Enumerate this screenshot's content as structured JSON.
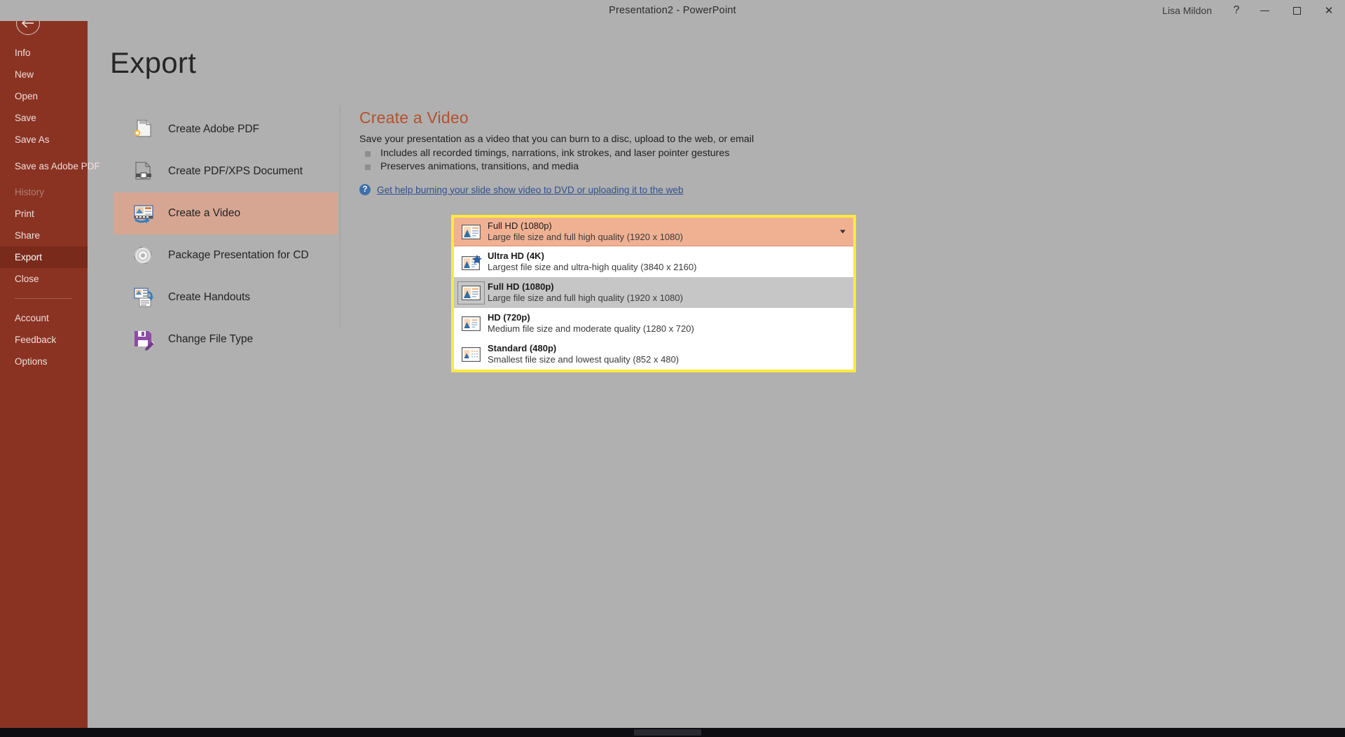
{
  "window": {
    "title": "Presentation2  -  PowerPoint",
    "user": "Lisa Mildon",
    "help_glyph": "?",
    "minimize_label": "Minimize",
    "restore_label": "Restore Down",
    "close_glyph": "✕"
  },
  "backstage": {
    "page_title": "Export",
    "back_label": "Back",
    "nav_items": [
      {
        "label": "Info",
        "state": "normal"
      },
      {
        "label": "New",
        "state": "normal"
      },
      {
        "label": "Open",
        "state": "normal"
      },
      {
        "label": "Save",
        "state": "normal"
      },
      {
        "label": "Save As",
        "state": "normal"
      },
      {
        "label": "Save as Adobe PDF",
        "state": "normal",
        "two_line": true
      },
      {
        "label": "History",
        "state": "disabled"
      },
      {
        "label": "Print",
        "state": "normal"
      },
      {
        "label": "Share",
        "state": "normal"
      },
      {
        "label": "Export",
        "state": "active"
      },
      {
        "label": "Close",
        "state": "normal"
      }
    ],
    "nav_items_bottom": [
      {
        "label": "Account",
        "state": "normal"
      },
      {
        "label": "Feedback",
        "state": "normal"
      },
      {
        "label": "Options",
        "state": "normal"
      }
    ]
  },
  "export_commands": [
    {
      "label": "Create Adobe PDF",
      "icon": "adobe-pdf-icon",
      "selected": false
    },
    {
      "label": "Create PDF/XPS Document",
      "icon": "pdf-xps-icon",
      "selected": false
    },
    {
      "label": "Create a Video",
      "icon": "video-icon",
      "selected": true
    },
    {
      "label": "Package Presentation for CD",
      "icon": "cd-disc-icon",
      "selected": false
    },
    {
      "label": "Create Handouts",
      "icon": "handouts-icon",
      "selected": false
    },
    {
      "label": "Change File Type",
      "icon": "file-type-icon",
      "selected": false
    }
  ],
  "pane": {
    "title": "Create a Video",
    "lead": "Save your presentation as a video that you can burn to a disc, upload to the web, or email",
    "bullets": [
      "Includes all recorded timings, narrations, ink strokes, and laser pointer gestures",
      "Preserves animations, transitions, and media"
    ],
    "help_icon_glyph": "?",
    "help_link": "Get help burning your slide show video to DVD or uploading it to the web"
  },
  "quality_dropdown": {
    "expanded": true,
    "selected_value": {
      "title": "Full HD (1080p)",
      "desc": "Large file size and full high quality (1920 x 1080)"
    },
    "options": [
      {
        "title": "Ultra HD (4K)",
        "desc": "Largest file size and ultra-high quality (3840 x 2160)",
        "icon": "slide-star-icon",
        "hovered": false,
        "boxed": false
      },
      {
        "title": "Full HD (1080p)",
        "desc": "Large file size and full high quality (1920 x 1080)",
        "icon": "slide-icon",
        "hovered": true,
        "boxed": true
      },
      {
        "title": "HD (720p)",
        "desc": "Medium file size and moderate quality (1280 x 720)",
        "icon": "slide-icon",
        "hovered": false,
        "boxed": false
      },
      {
        "title": "Standard (480p)",
        "desc": "Smallest file size and lowest quality (852 x 480)",
        "icon": "slide-dotted-icon",
        "hovered": false,
        "boxed": false
      }
    ]
  },
  "colors": {
    "sidebar_red": "#8a3323",
    "sidebar_active_red": "#7a2a1b",
    "backstage_gray": "#b0b0b0",
    "accent_orange": "#b5512e",
    "selected_peach": "#d7a693",
    "dropdown_selected_peach": "#f0b193",
    "highlight_yellow": "#ffe93d",
    "hover_gray": "#c6c6c6",
    "link_blue": "#2f4f8f"
  }
}
